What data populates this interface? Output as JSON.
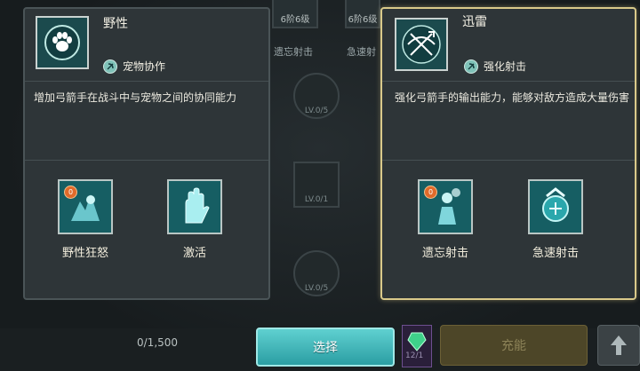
{
  "background": {
    "top_tags": [
      "6阶6级",
      "6阶6级"
    ],
    "top_captions": [
      "遗忘射击",
      "急速射"
    ],
    "tree_levels": [
      "LV.0/5",
      "LV.0/1",
      "LV.0/5"
    ]
  },
  "left_panel": {
    "title": "野性",
    "category": "宠物协作",
    "description": "增加弓箭手在战斗中与宠物之间的协同能力",
    "skills": [
      {
        "label": "野性狂怒",
        "badge": "0"
      },
      {
        "label": "激活"
      }
    ],
    "main_icon": "paw-icon"
  },
  "right_panel": {
    "title": "迅雷",
    "category": "强化射击",
    "description": "强化弓箭手的输出能力，能够对敌方造成大量伤害",
    "skills": [
      {
        "label": "遗忘射击",
        "badge": "0"
      },
      {
        "label": "急速射击"
      }
    ],
    "main_icon": "crossbow-icon"
  },
  "bottom": {
    "progress": "0/1,500",
    "select_label": "选择",
    "gem_count": "12/1",
    "disabled_label": "充能",
    "up_icon": "arrow-up-icon"
  },
  "colors": {
    "selected_border": "#d9c98a",
    "select_button": "#3fb4b8"
  }
}
